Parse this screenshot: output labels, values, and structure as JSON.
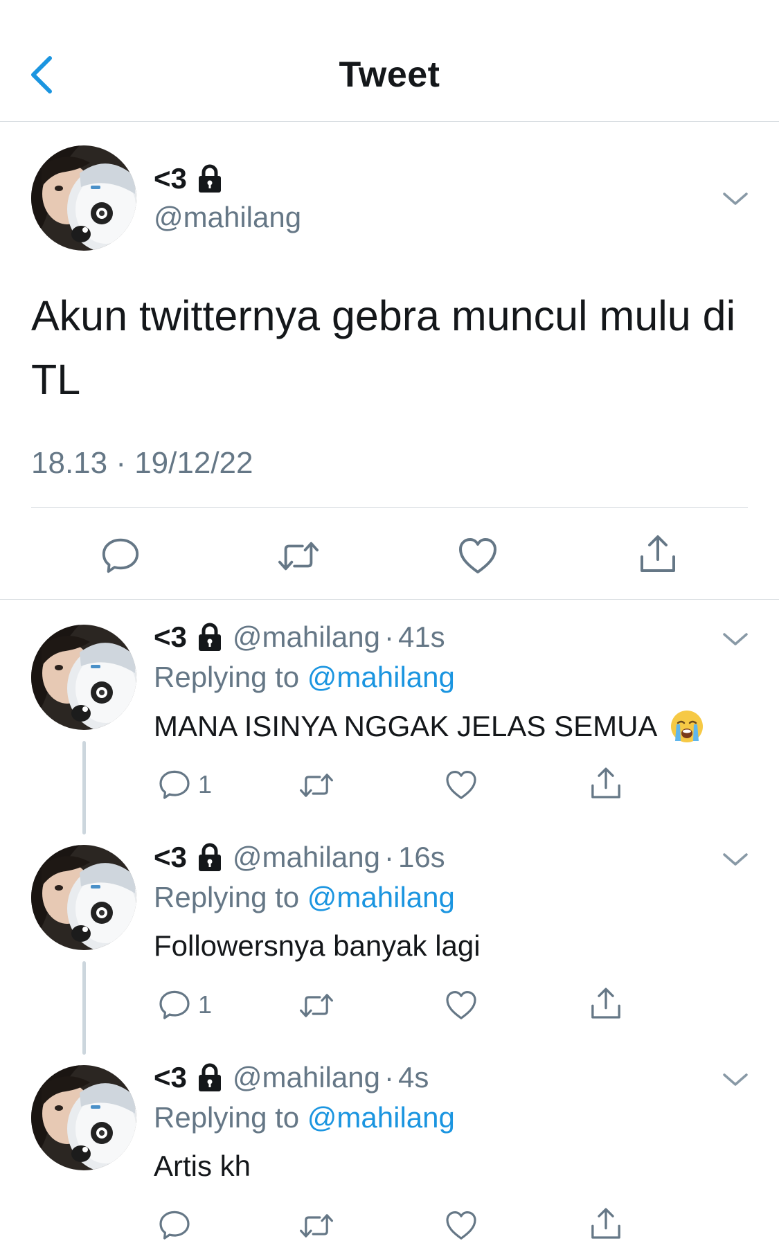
{
  "header": {
    "title": "Tweet"
  },
  "tweet": {
    "display_name": "<3",
    "handle": "@mahilang",
    "text": "Akun twitternya gebra muncul mulu di TL",
    "timestamp": "18.13 · 19/12/22",
    "actions": [
      "reply-icon",
      "retweet-icon",
      "like-icon",
      "share-icon"
    ]
  },
  "replies": [
    {
      "display_name": "<3",
      "handle": "@mahilang",
      "dot": "·",
      "time": "41s",
      "replying_prefix": "Replying to",
      "replying_to": "@mahilang",
      "text": "MANA ISINYA NGGAK JELAS SEMUA",
      "emoji": "loudly-crying-face",
      "reply_count": "1"
    },
    {
      "display_name": "<3",
      "handle": "@mahilang",
      "dot": "·",
      "time": "16s",
      "replying_prefix": "Replying to",
      "replying_to": "@mahilang",
      "text": "Followersnya banyak lagi",
      "reply_count": "1"
    },
    {
      "display_name": "<3",
      "handle": "@mahilang",
      "dot": "·",
      "time": "4s",
      "replying_prefix": "Replying to",
      "replying_to": "@mahilang",
      "text": "Artis kh",
      "reply_count": ""
    }
  ],
  "colors": {
    "accent": "#1b95e0",
    "muted": "#657786",
    "divider": "#d8dde1",
    "thread_line": "#ccd6dd"
  }
}
